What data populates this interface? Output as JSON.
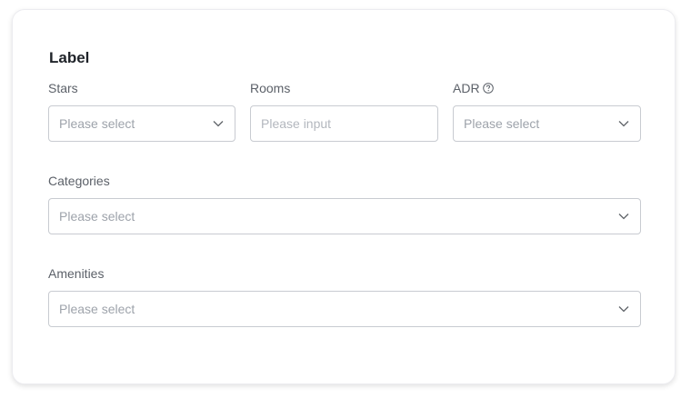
{
  "form": {
    "title": "Label",
    "stars": {
      "label": "Stars",
      "placeholder": "Please select"
    },
    "rooms": {
      "label": "Rooms",
      "placeholder": "Please input"
    },
    "adr": {
      "label": "ADR",
      "placeholder": "Please select",
      "help_icon": "question-circle-icon"
    },
    "categories": {
      "label": "Categories",
      "placeholder": "Please select"
    },
    "amenities": {
      "label": "Amenities",
      "placeholder": "Please select"
    }
  },
  "colors": {
    "label": "#5c6169",
    "placeholder": "#9ea3ab",
    "border": "#c8cbd1",
    "title": "#1f2329"
  }
}
